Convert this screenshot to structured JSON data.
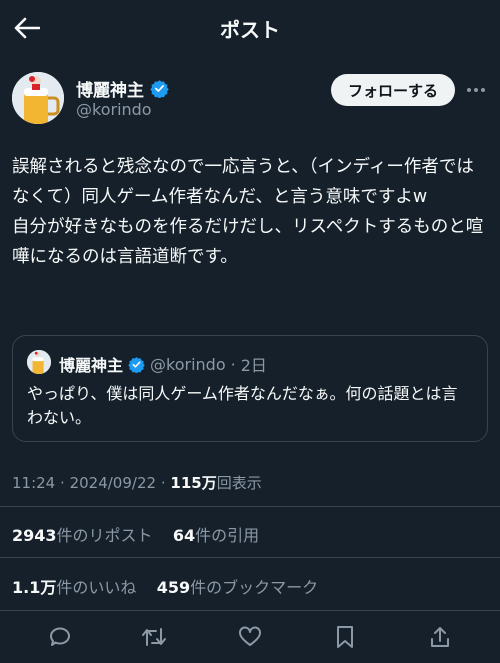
{
  "header": {
    "back_icon": "arrow-left-icon",
    "title": "ポスト"
  },
  "author": {
    "name": "博麗神主",
    "handle": "@korindo",
    "verified_icon": "verified-badge-icon"
  },
  "follow_button": {
    "label": "フォローする"
  },
  "more_icon": "more-horizontal-icon",
  "post": {
    "text": "誤解されると残念なので一応言うと、（インディー作者ではなくて）同人ゲーム作者なんだ、と言う意味ですよw\n自分が好きなものを作るだけだし、リスペクトするものと喧嘩になるのは言語道断です。"
  },
  "quote": {
    "name": "博麗神主",
    "handle": "@korindo",
    "separator": "·",
    "time": "2日",
    "text": "やっぱり、僕は同人ゲーム作者なんだなぁ。何の話題とは言わない。"
  },
  "meta": {
    "time": "11:24",
    "separator": "·",
    "date": "2024/09/22",
    "separator2": "·",
    "views": "115万",
    "views_label": "回表示"
  },
  "stats": {
    "reposts_count": "2943",
    "reposts_label": "件のリポスト",
    "quotes_count": "64",
    "quotes_label": "件の引用",
    "likes_count": "1.1万",
    "likes_label": "件のいいね",
    "bookmarks_count": "459",
    "bookmarks_label": "件のブックマーク"
  },
  "actions": [
    "reply-icon",
    "repost-icon",
    "like-icon",
    "bookmark-icon",
    "share-icon"
  ],
  "colors": {
    "background": "#15202b",
    "accent": "#1d9bf0",
    "muted": "#8b98a5",
    "border": "#38444d"
  }
}
